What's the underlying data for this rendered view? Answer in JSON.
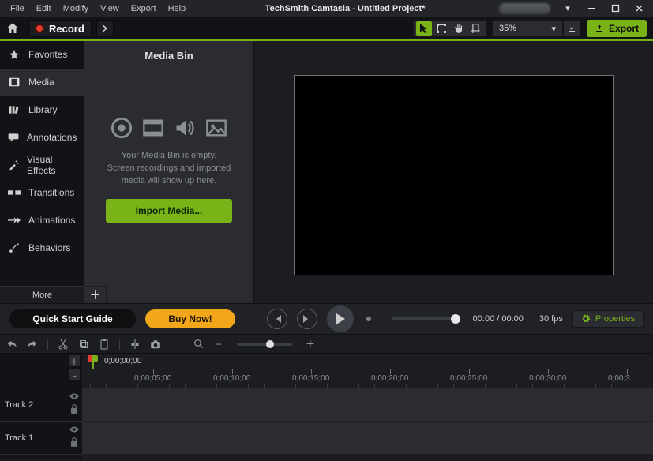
{
  "menubar": {
    "items": [
      "File",
      "Edit",
      "Modify",
      "View",
      "Export",
      "Help"
    ]
  },
  "window": {
    "title": "TechSmith Camtasia - Untitled Project*"
  },
  "toolbar": {
    "record_label": "Record",
    "zoom_value": "35%",
    "export_label": "Export"
  },
  "sidebar": {
    "items": [
      {
        "label": "Favorites"
      },
      {
        "label": "Media"
      },
      {
        "label": "Library"
      },
      {
        "label": "Annotations"
      },
      {
        "label": "Visual Effects"
      },
      {
        "label": "Transitions"
      },
      {
        "label": "Animations"
      },
      {
        "label": "Behaviors"
      }
    ],
    "more_label": "More"
  },
  "mediabin": {
    "title": "Media Bin",
    "empty_line1": "Your Media Bin is empty.",
    "empty_line2": "Screen recordings and imported",
    "empty_line3": "media will show up here.",
    "import_label": "Import Media..."
  },
  "promo": {
    "guide_label": "Quick Start Guide",
    "buy_label": "Buy Now!"
  },
  "playback": {
    "time_current": "00:00",
    "time_total": "00:00",
    "fps": "30 fps",
    "properties_label": "Properties"
  },
  "timeline": {
    "playhead_time": "0;00;00;00",
    "ruler_labels": [
      "0;00;05;00",
      "0;00;10;00",
      "0;00;15;00",
      "0;00;20;00",
      "0;00;25;00",
      "0;00;30;00",
      "0;00;3"
    ],
    "tracks": [
      "Track 2",
      "Track 1"
    ]
  }
}
